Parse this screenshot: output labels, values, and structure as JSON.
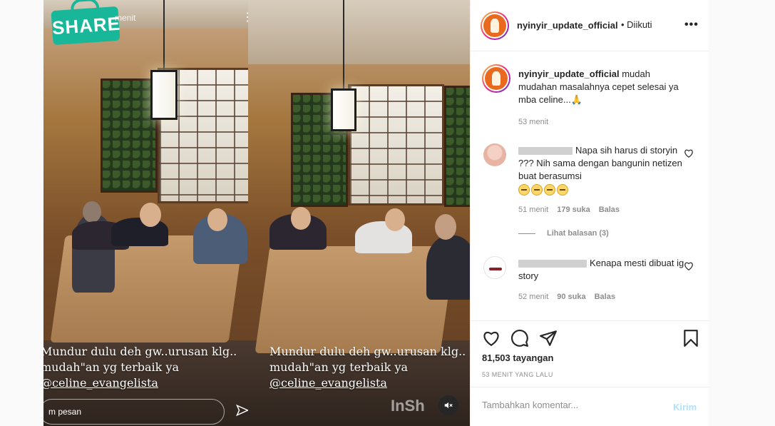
{
  "video": {
    "story_time": "menit",
    "share_badge": "SHARE",
    "caption_lines": [
      "Mundur dulu deh gw..urusan klg..",
      "mudah\"an yg terbaik ya",
      "@celine_evangelista"
    ],
    "reply_placeholder": "m pesan",
    "watermark": "InSh",
    "more_icon": "more-vertical-icon",
    "mute_icon": "muted-speaker-icon"
  },
  "header": {
    "username": "nyinyir_update_official",
    "follow_status": "• Diikuti",
    "more_label": "•••"
  },
  "caption": {
    "username": "nyinyir_update_official",
    "text": "mudah mudahan masalahnya cepet selesai ya mba celine...🙏",
    "time": "53 menit"
  },
  "comments": [
    {
      "text": "Napa sih harus di storyin ??? Nih sama dengan bangunin netizen buat berasumsi",
      "emoji_count": 4,
      "time": "51 menit",
      "likes": "179 suka",
      "reply": "Balas",
      "view_replies": "Lihat balasan (3)"
    },
    {
      "text": "Kenapa mesti dibuat ig story",
      "time": "52 menit",
      "likes": "90 suka",
      "reply": "Balas"
    }
  ],
  "actions": {
    "icons": [
      "heart-icon",
      "comment-icon",
      "share-icon",
      "bookmark-icon"
    ],
    "views": "81,503 tayangan",
    "time_ago": "53 MENIT YANG LALU"
  },
  "add_comment": {
    "placeholder": "Tambahkan komentar...",
    "send_label": "Kirim"
  },
  "colors": {
    "share_badge": "#19b79a",
    "link_disabled": "#b2dffc",
    "muted_text": "#8e8e8e"
  }
}
